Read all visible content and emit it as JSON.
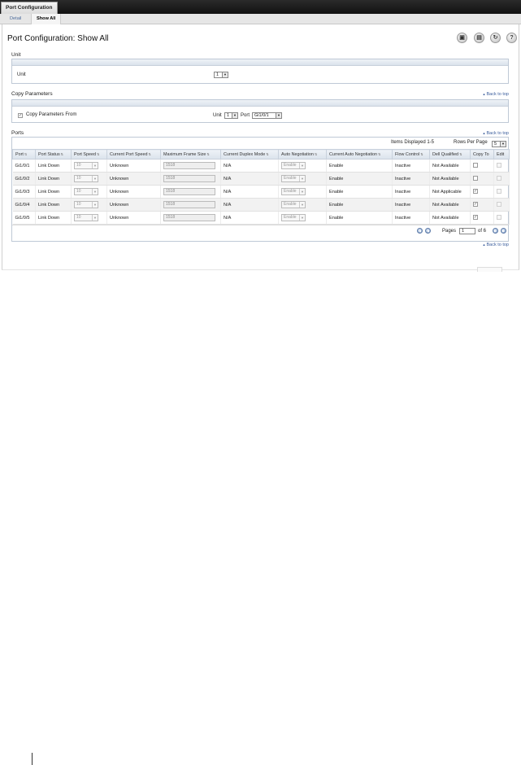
{
  "tabs": {
    "active": "Port Configuration"
  },
  "subnav": {
    "detail": "Detail",
    "show_all": "Show All"
  },
  "page_title": "Port Configuration: Show All",
  "toolbar": {
    "save_icon": "save-icon",
    "print_icon": "print-icon",
    "refresh_icon": "refresh-icon",
    "help_icon": "help-icon",
    "help_label": "?"
  },
  "unit_section": {
    "title": "Unit",
    "label": "Unit",
    "value": "1"
  },
  "copy_section": {
    "title": "Copy Parameters",
    "back_to_top": "Back to top",
    "checkbox_label": "Copy Parameters From",
    "checked": true,
    "unit_label": "Unit",
    "unit_value": "1",
    "port_label": "Port",
    "port_value": "Gi1/0/1"
  },
  "ports_section": {
    "title": "Ports",
    "back_to_top": "Back to top",
    "items_displayed": "Items Displayed 1-5",
    "rows_per_page_label": "Rows Per Page",
    "rows_per_page_value": "5",
    "columns": [
      "Port",
      "Port Status",
      "Port Speed",
      "Current Port Speed",
      "Maximum Frame Size",
      "Current Duplex Mode",
      "Auto Negotiation",
      "Current Auto Negotiation",
      "Flow Control",
      "Dell Qualified",
      "Copy To",
      "Edit"
    ],
    "rows": [
      {
        "port": "Gi1/0/1",
        "status": "Link Down",
        "speed": "10",
        "current_speed": "Unknown",
        "max_frame": "1518",
        "duplex": "N/A",
        "auto_neg": "Enable",
        "current_auto_neg": "Enable",
        "flow": "Inactive",
        "dell_qualified": "Not Available",
        "copy_to": false,
        "edit": false
      },
      {
        "port": "Gi1/0/2",
        "status": "Link Down",
        "speed": "10",
        "current_speed": "Unknown",
        "max_frame": "1518",
        "duplex": "N/A",
        "auto_neg": "Enable",
        "current_auto_neg": "Enable",
        "flow": "Inactive",
        "dell_qualified": "Not Available",
        "copy_to": false,
        "edit": false
      },
      {
        "port": "Gi1/0/3",
        "status": "Link Down",
        "speed": "10",
        "current_speed": "Unknown",
        "max_frame": "1518",
        "duplex": "N/A",
        "auto_neg": "Enable",
        "current_auto_neg": "Enable",
        "flow": "Inactive",
        "dell_qualified": "Not Applicable",
        "copy_to": true,
        "edit": false
      },
      {
        "port": "Gi1/0/4",
        "status": "Link Down",
        "speed": "10",
        "current_speed": "Unknown",
        "max_frame": "1518",
        "duplex": "N/A",
        "auto_neg": "Enable",
        "current_auto_neg": "Enable",
        "flow": "Inactive",
        "dell_qualified": "Not Available",
        "copy_to": true,
        "edit": false
      },
      {
        "port": "Gi1/0/5",
        "status": "Link Down",
        "speed": "10",
        "current_speed": "Unknown",
        "max_frame": "1518",
        "duplex": "N/A",
        "auto_neg": "Enable",
        "current_auto_neg": "Enable",
        "flow": "Inactive",
        "dell_qualified": "Not Available",
        "copy_to": true,
        "edit": false
      }
    ],
    "pager": {
      "label": "Pages",
      "current": "1",
      "of": "of 6"
    }
  },
  "bottom_back_to_top": "Back to top"
}
